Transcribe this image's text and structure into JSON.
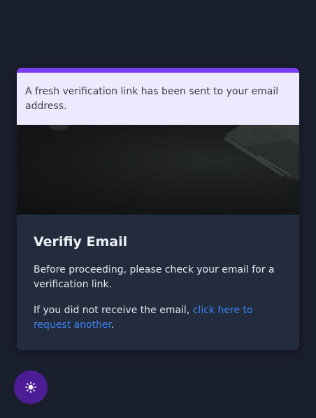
{
  "alert": {
    "message": "A fresh verification link has been sent to your email address."
  },
  "hero": {
    "image": "dark-textured-fabric-photo"
  },
  "card": {
    "title": "Verifiy Email",
    "instruction": "Before proceeding, please check your email for a verification link.",
    "resend_prefix": "If you did not receive the email, ",
    "resend_link": "click here to request another",
    "resend_suffix": "."
  },
  "theme_toggle": {
    "icon": "sun-icon"
  },
  "colors": {
    "background": "#1a1f2e",
    "card": "#232c3d",
    "accent": "#7a3cf0",
    "alert_bg": "#ede9fe",
    "link": "#3b82f6",
    "toggle_bg": "#4c1d95"
  }
}
